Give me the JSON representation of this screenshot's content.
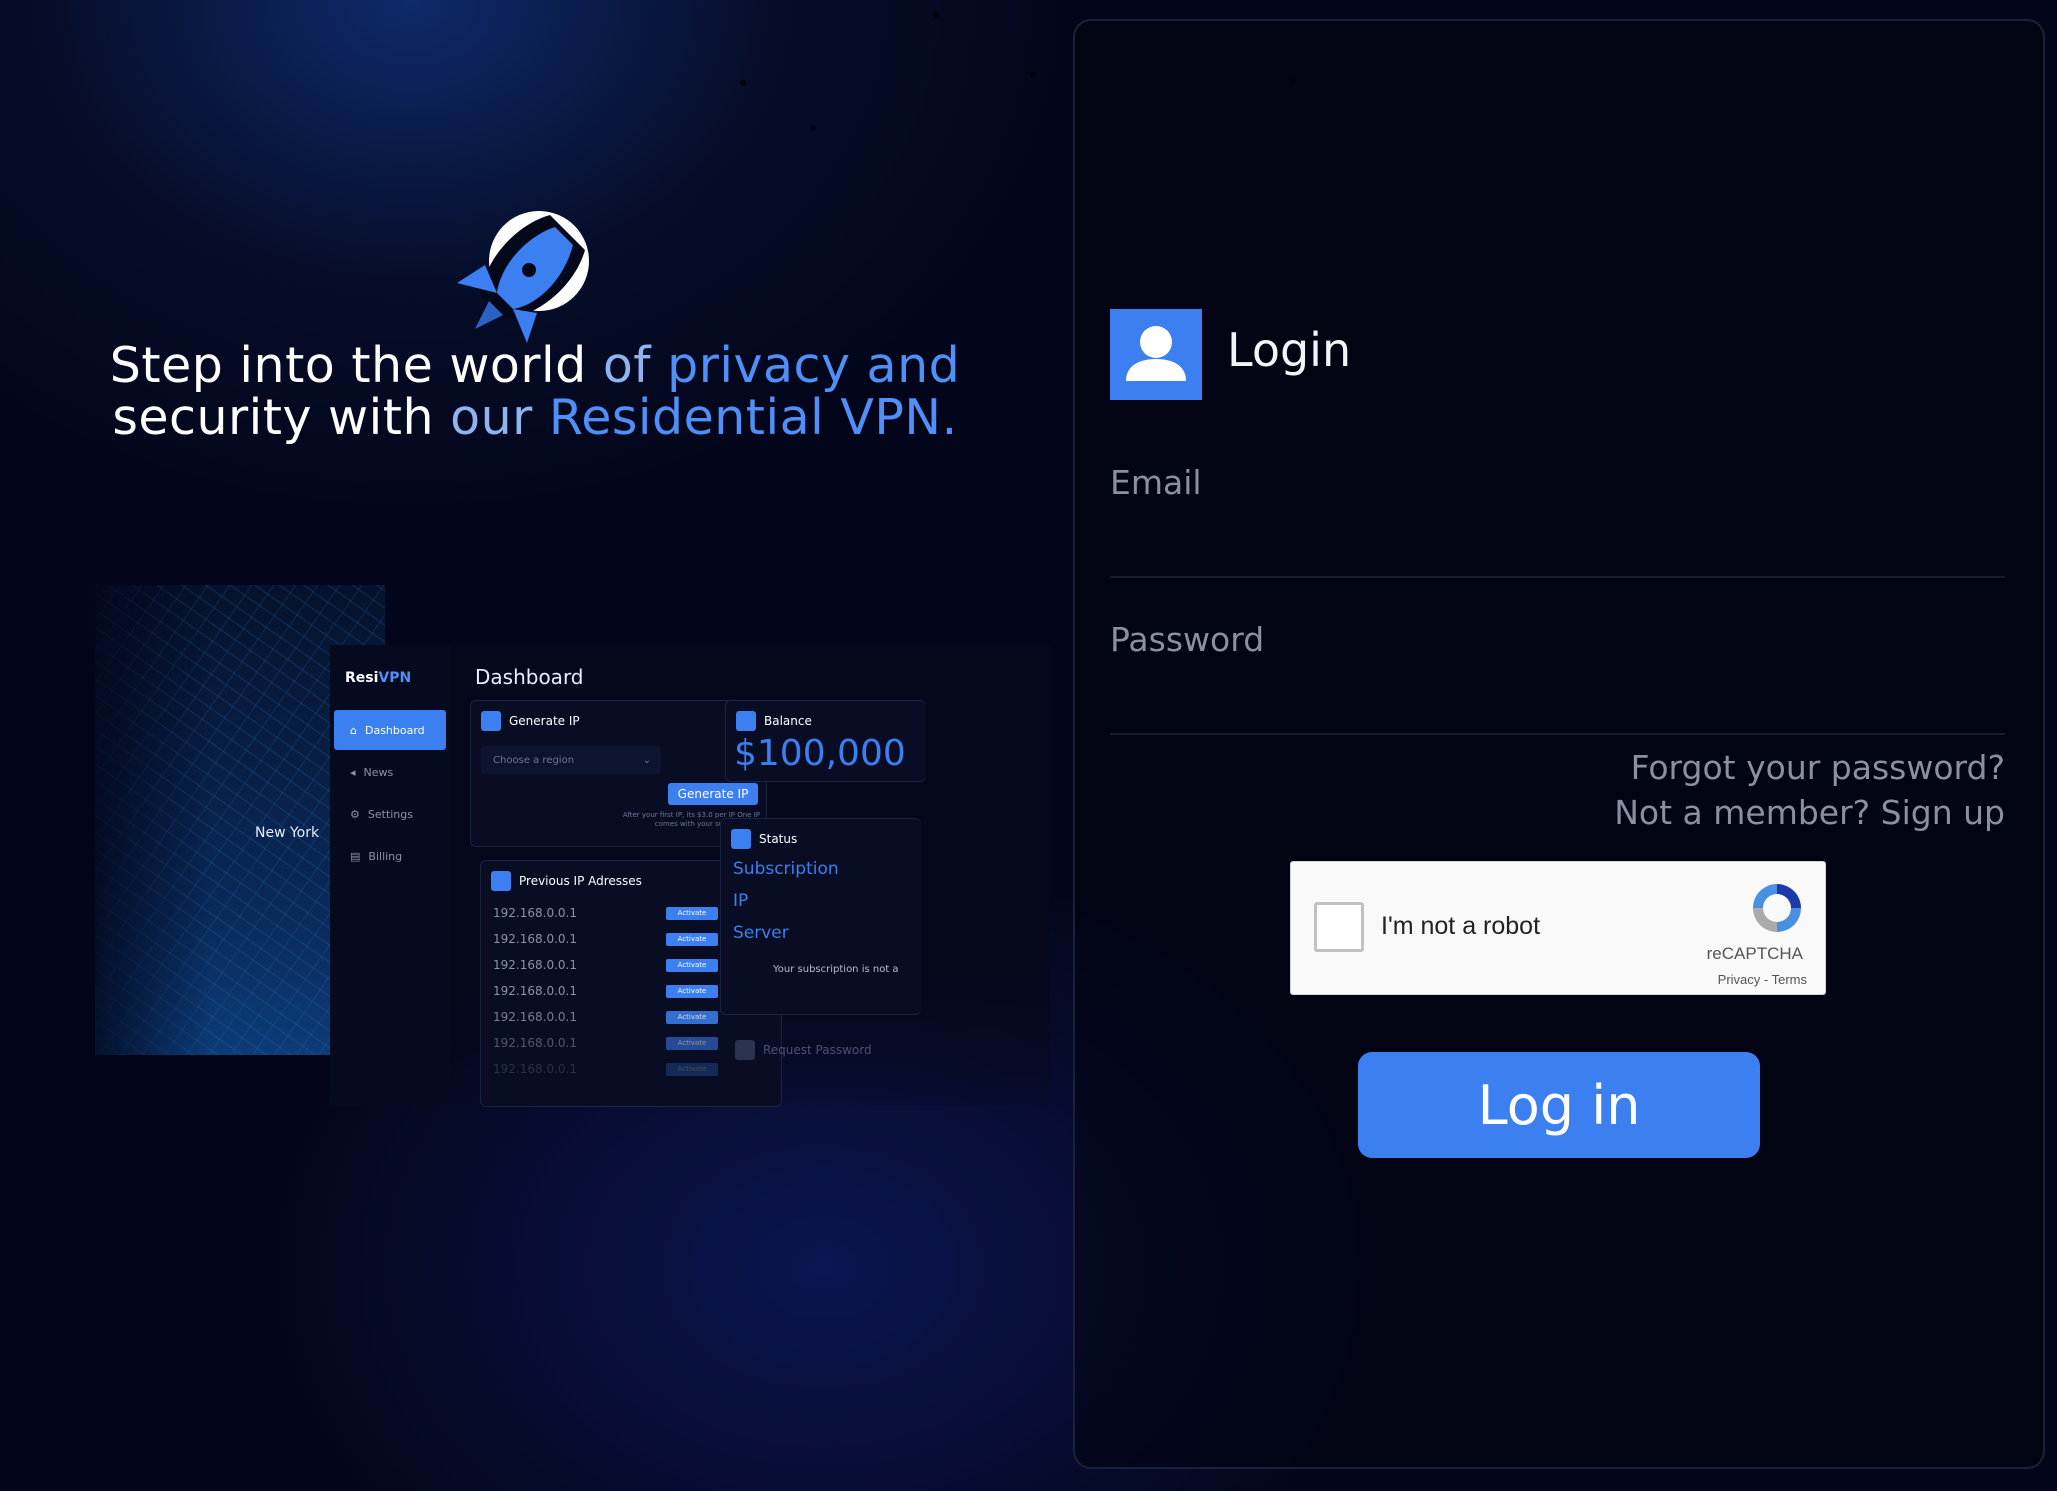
{
  "hero": {
    "line1_a": "Step into the world ",
    "line1_b": "of ",
    "line1_c": "privacy and",
    "line2_a": "security with ",
    "line2_b": "our ",
    "line2_c": "Residential VPN."
  },
  "mockup": {
    "brand_a": "Resi",
    "brand_b": "VPN",
    "map_label": "New York",
    "nav": [
      "Dashboard",
      "News",
      "Settings",
      "Billing"
    ],
    "page_title": "Dashboard",
    "generate": {
      "title": "Generate IP",
      "select_placeholder": "Choose a region",
      "button": "Generate IP",
      "note": "After your first IP, its $3.0 per IP One IP comes with your subscription."
    },
    "previous": {
      "title": "Previous IP Adresses",
      "ips": [
        "192.168.0.0.1",
        "192.168.0.0.1",
        "192.168.0.0.1",
        "192.168.0.0.1",
        "192.168.0.0.1",
        "192.168.0.0.1",
        "192.168.0.0.1"
      ],
      "activate_label": "Activate"
    },
    "balance": {
      "title": "Balance",
      "amount": "$100,000"
    },
    "status": {
      "title": "Status",
      "items": [
        "Subscription",
        "IP",
        "Server"
      ],
      "note": "Your subscription is not a"
    },
    "request_password": "Request Password"
  },
  "login": {
    "title": "Login",
    "email_label": "Email",
    "password_label": "Password",
    "forgot": "Forgot your password?",
    "signup": "Not a member? Sign up",
    "captcha_label": "I'm not a robot",
    "captcha_brand": "reCAPTCHA",
    "captcha_links": "Privacy - Terms",
    "button": "Log in"
  },
  "colors": {
    "accent": "#3b7ff0",
    "background": "#03061a",
    "muted": "#8a90a0"
  }
}
